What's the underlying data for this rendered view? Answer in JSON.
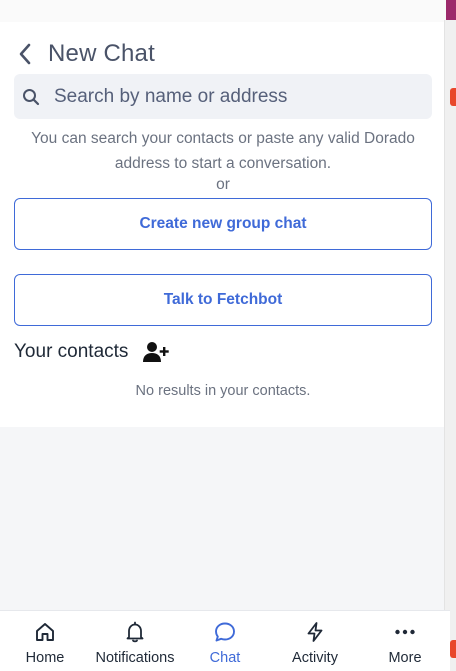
{
  "header": {
    "title": "New Chat"
  },
  "search": {
    "placeholder": "Search by name or address",
    "value": ""
  },
  "help": {
    "text": "You can search your contacts or paste any valid Dorado address to start a conversation.",
    "or": "or"
  },
  "actions": {
    "group_label": "Create new group chat",
    "fetchbot_label": "Talk to Fetchbot"
  },
  "contacts": {
    "heading": "Your contacts",
    "empty": "No results in your contacts."
  },
  "nav": {
    "items": [
      {
        "label": "Home",
        "icon": "home-icon"
      },
      {
        "label": "Notifications",
        "icon": "bell-icon"
      },
      {
        "label": "Chat",
        "icon": "chat-icon",
        "active": true
      },
      {
        "label": "Activity",
        "icon": "lightning-icon"
      },
      {
        "label": "More",
        "icon": "more-icon"
      }
    ]
  },
  "colors": {
    "accent": "#3f6ad8",
    "text": "#1f2937",
    "muted": "#6b7280",
    "title": "#4a5368"
  }
}
